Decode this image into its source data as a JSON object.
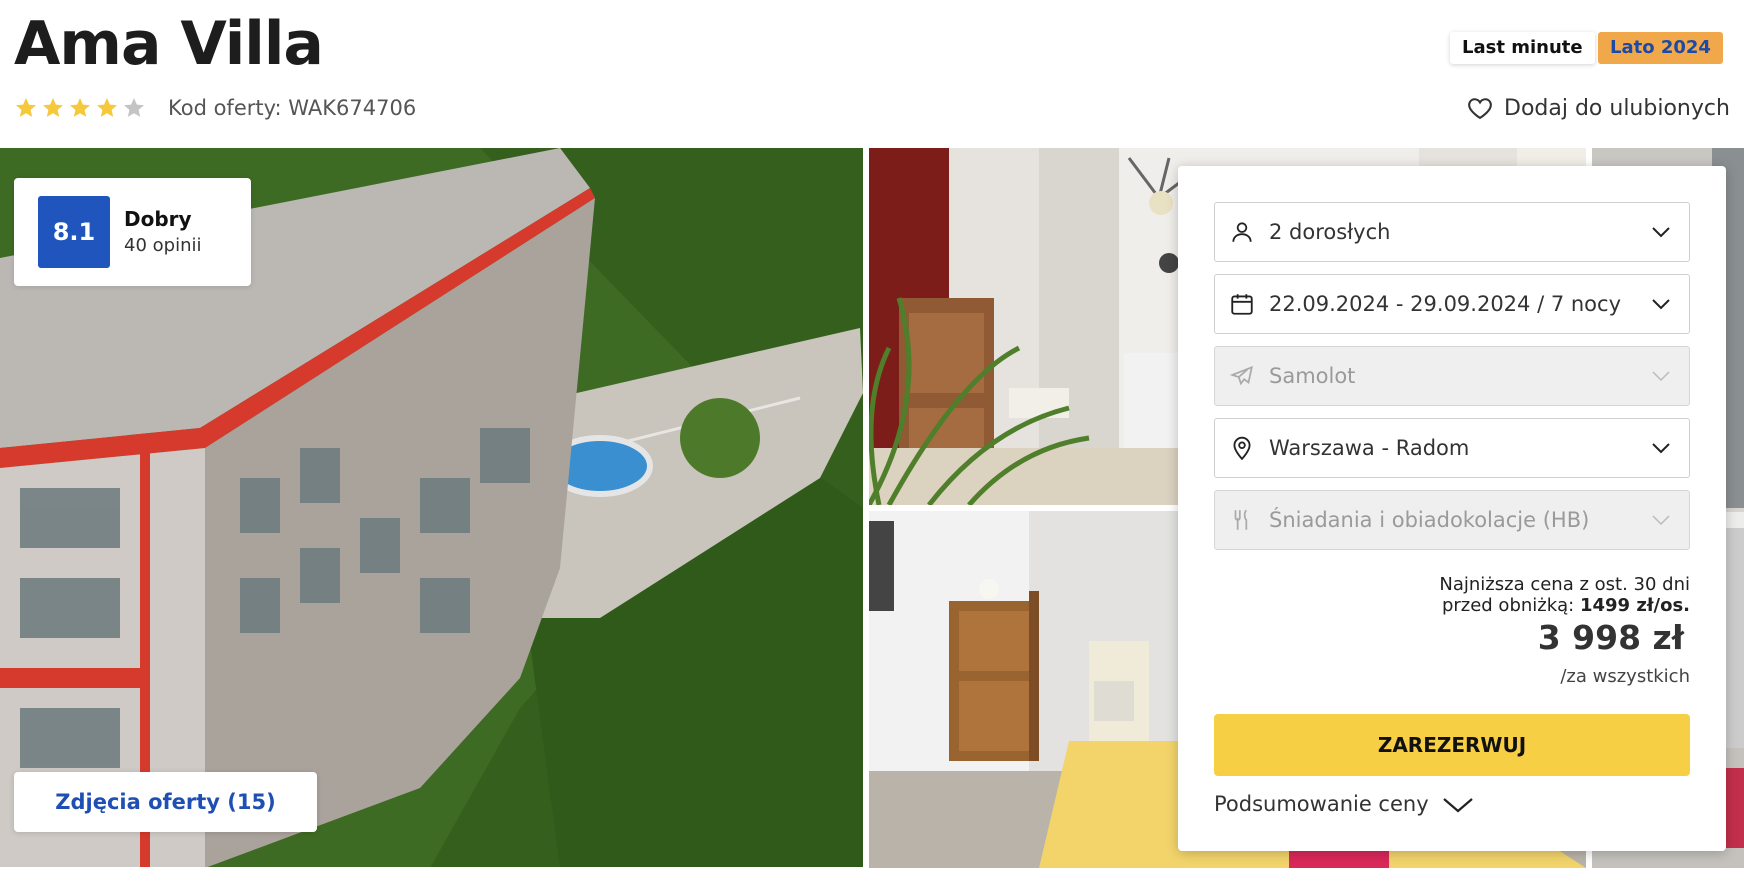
{
  "header": {
    "title": "Ama Villa",
    "stars": {
      "filled": 4,
      "total": 5
    },
    "offer_code": "Kod oferty: WAK674706",
    "badges": {
      "last_minute": "Last minute",
      "season": "Lato 2024"
    },
    "favorite_label": "Dodaj do ulubionych"
  },
  "rating": {
    "score": "8.1",
    "label": "Dobry",
    "reviews": "40 opinii"
  },
  "gallery": {
    "photos_button": "Zdjęcia oferty (15)"
  },
  "booking": {
    "travelers": "2 dorosłych",
    "dates": "22.09.2024 - 29.09.2024 / 7 nocy",
    "transport": "Samolot",
    "departure": "Warszawa - Radom",
    "board": "Śniadania i obiadokolacje (HB)",
    "lowest_line1": "Najniższa cena z ost. 30 dni",
    "lowest_line2_prefix": "przed obniżką: ",
    "lowest_value": "1499 zł/os.",
    "price": "3 998 zł",
    "price_note": "/za wszystkich",
    "reserve_label": "ZAREZERWUJ",
    "summary_label": "Podsumowanie ceny"
  },
  "colors": {
    "star": "#f6c83b",
    "star_empty": "#c4c4c4",
    "rating_bg": "#1f55bd",
    "reserve_bg": "#f7cf45",
    "season_badge_bg": "#f1a84a",
    "link_blue": "#1f4fb3"
  },
  "icons": {
    "travelers": "person-icon",
    "dates": "calendar-icon",
    "transport": "plane-icon",
    "departure": "location-pin-icon",
    "board": "cutlery-icon",
    "favorite": "heart-icon"
  }
}
